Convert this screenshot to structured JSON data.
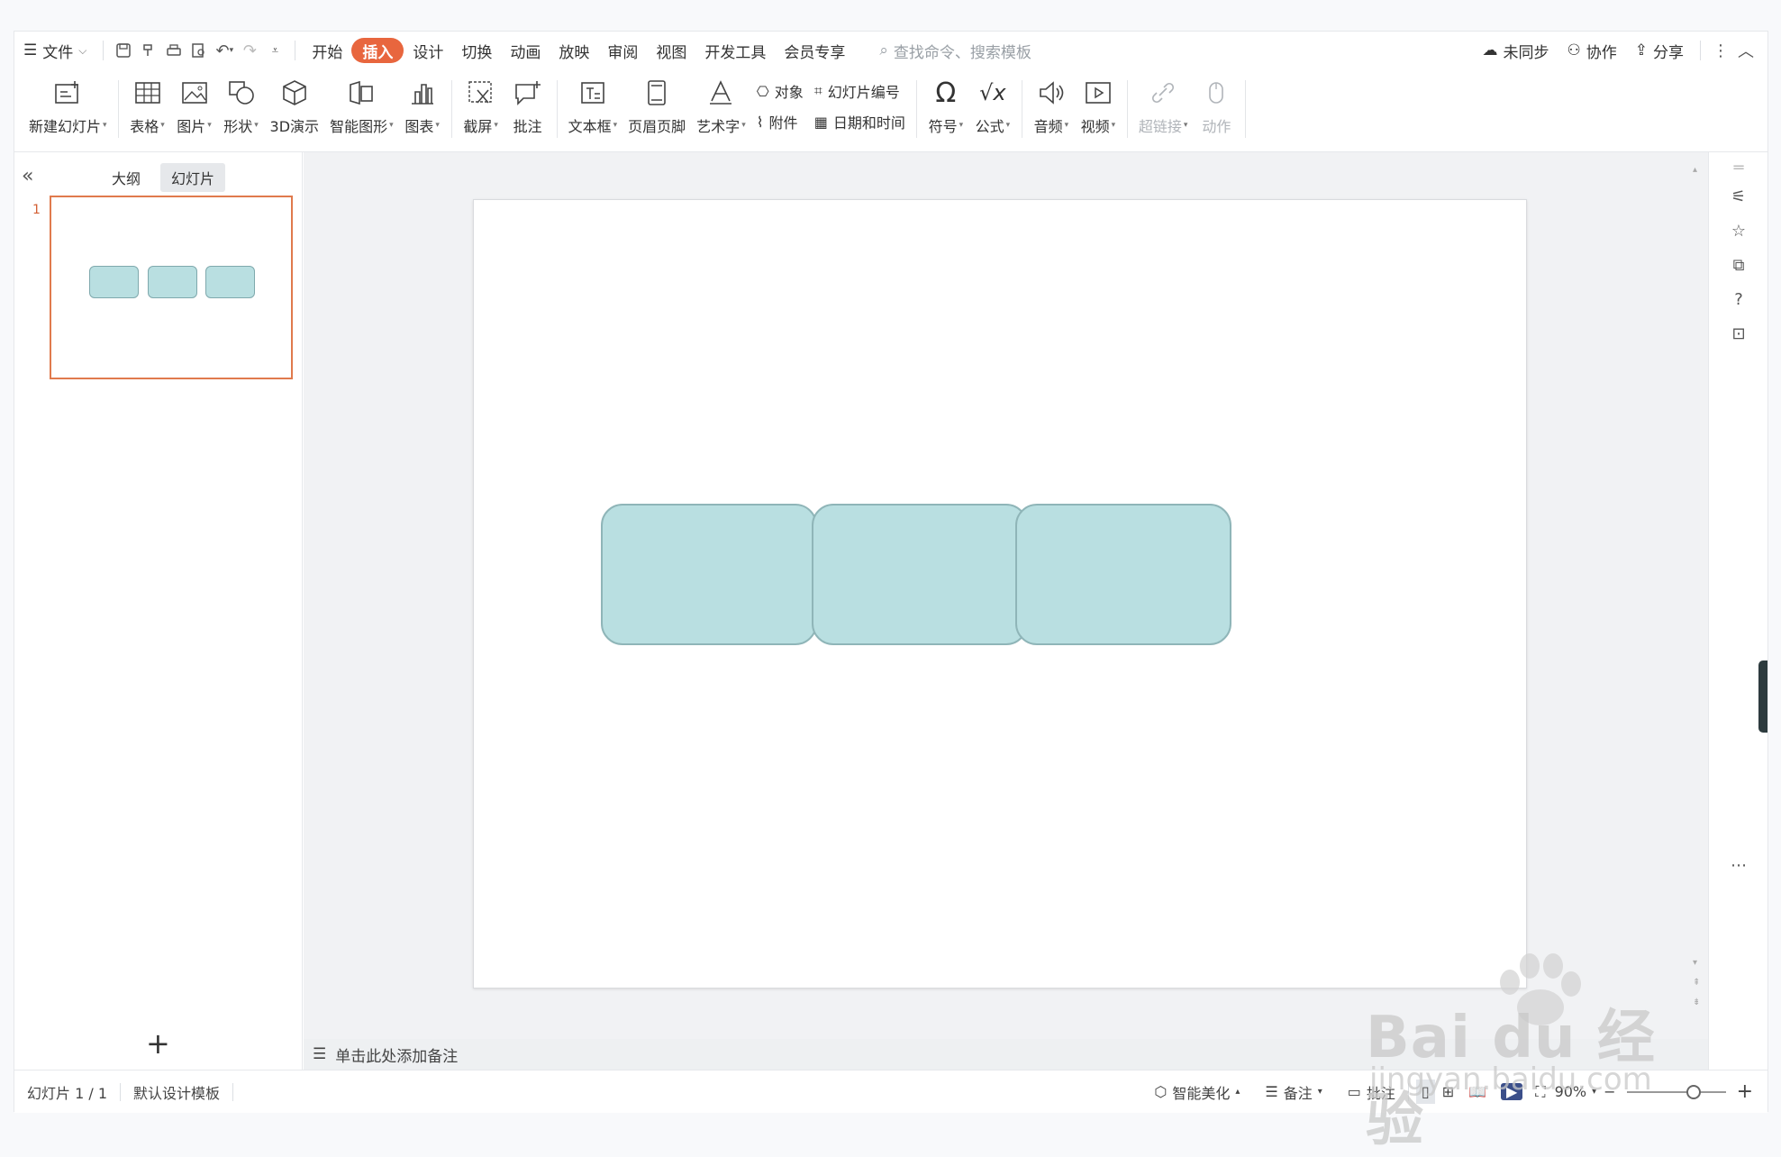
{
  "menubar": {
    "file_label": "文件",
    "tabs": [
      {
        "label": "开始",
        "active": false
      },
      {
        "label": "插入",
        "active": true
      },
      {
        "label": "设计",
        "active": false
      },
      {
        "label": "切换",
        "active": false
      },
      {
        "label": "动画",
        "active": false
      },
      {
        "label": "放映",
        "active": false
      },
      {
        "label": "审阅",
        "active": false
      },
      {
        "label": "视图",
        "active": false
      },
      {
        "label": "开发工具",
        "active": false
      },
      {
        "label": "会员专享",
        "active": false
      }
    ],
    "search_placeholder": "查找命令、搜索模板",
    "sync_label": "未同步",
    "collab_label": "协作",
    "share_label": "分享",
    "active_tab_color": "#e8663e"
  },
  "ribbon": {
    "new_slide": "新建幻灯片",
    "table": "表格",
    "picture": "图片",
    "shape": "形状",
    "demo3d": "3D演示",
    "smartart": "智能图形",
    "chart": "图表",
    "screenshot": "截屏",
    "comment": "批注",
    "textbox": "文本框",
    "header_footer": "页眉页脚",
    "wordart": "艺术字",
    "object": "对象",
    "attachment": "附件",
    "slide_number": "幻灯片编号",
    "datetime": "日期和时间",
    "symbol": "符号",
    "formula": "公式",
    "audio": "音频",
    "video": "视频",
    "hyperlink": "超链接",
    "action": "动作"
  },
  "leftpane": {
    "tab_outline": "大纲",
    "tab_slides": "幻灯片",
    "slide_number": "1",
    "add_slide": "+"
  },
  "notes": {
    "placeholder": "单击此处添加备注"
  },
  "status": {
    "slide_counter": "幻灯片 1 / 1",
    "template": "默认设计模板",
    "beautify": "智能美化",
    "notes": "备注",
    "comments": "批注",
    "zoom": "90%"
  },
  "slide": {
    "shape_fill": "#b9dfe1",
    "shape_border": "#8fb5b8",
    "shape_count": 3
  },
  "watermark": {
    "brand": "Bai du 经验",
    "url": "jingyan.baidu.com"
  }
}
